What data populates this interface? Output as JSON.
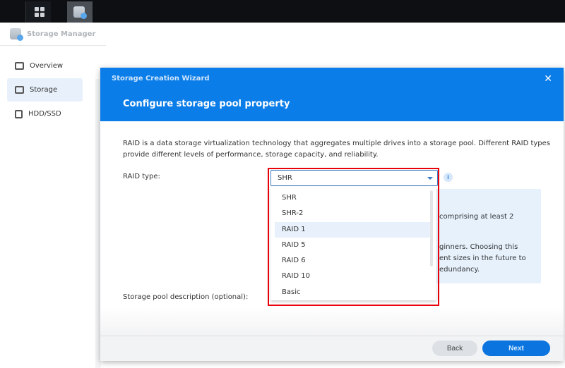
{
  "taskbar": {
    "icons": [
      "main-menu-icon",
      "storage-manager-icon"
    ]
  },
  "app": {
    "title": "Storage Manager"
  },
  "sidebar": {
    "items": [
      {
        "label": "Overview",
        "icon": "overview-icon"
      },
      {
        "label": "Storage",
        "icon": "storage-icon",
        "active": true
      },
      {
        "label": "HDD/SSD",
        "icon": "hdd-icon"
      }
    ]
  },
  "dialog": {
    "title": "Storage Creation Wizard",
    "heading": "Configure storage pool property",
    "description": "RAID is a data storage virtualization technology that aggregates multiple drives into a storage pool. Different RAID types provide different levels of performance, storage capacity, and reliability.",
    "raid_label": "RAID type:",
    "raid_value": "SHR",
    "raid_options": [
      "SHR",
      "SHR-2",
      "RAID 1",
      "RAID 5",
      "RAID 6",
      "RAID 10",
      "Basic"
    ],
    "highlighted_option": "RAID 1",
    "info_lines": [
      "comprising at least 2",
      "ginners. Choosing this",
      "ent sizes in the future to",
      "edundancy."
    ],
    "description_label": "Storage pool description (optional):",
    "back": "Back",
    "next": "Next",
    "colors": {
      "header": "#0b7de8",
      "highlight_box": "#e8000b",
      "next_button": "#0b74de"
    }
  }
}
